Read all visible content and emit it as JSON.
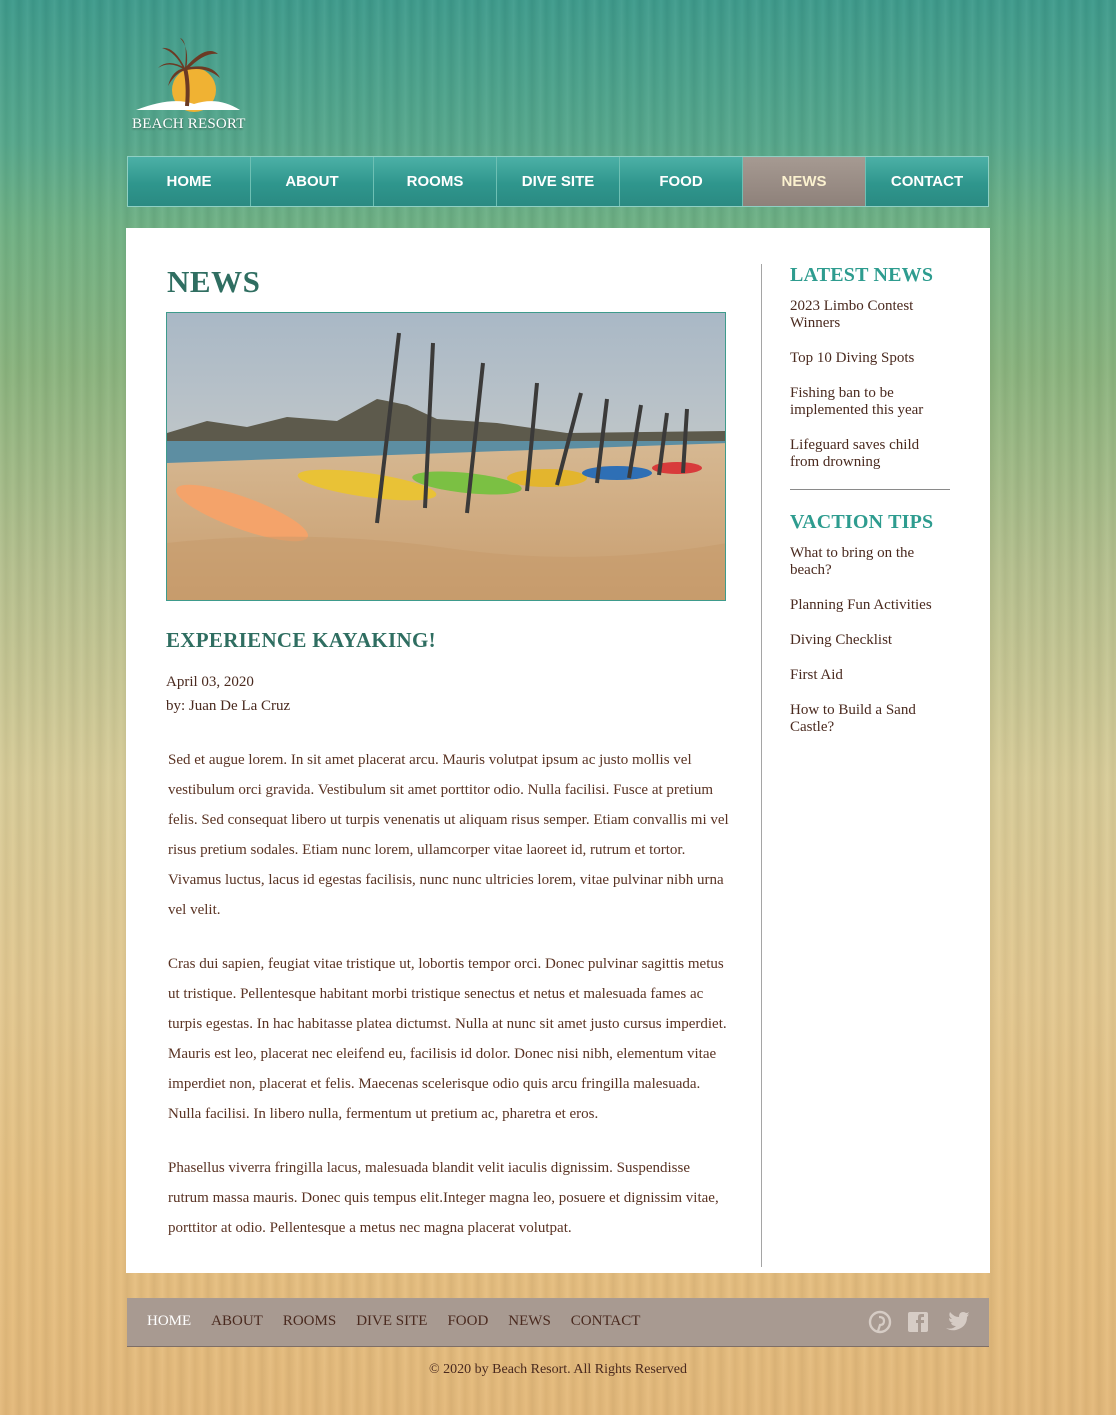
{
  "logo": {
    "text": "BEACH RESORT"
  },
  "nav": {
    "items": [
      {
        "label": "HOME"
      },
      {
        "label": "ABOUT"
      },
      {
        "label": "ROOMS"
      },
      {
        "label": "DIVE SITE"
      },
      {
        "label": "FOOD"
      },
      {
        "label": "NEWS",
        "active": true
      },
      {
        "label": "CONTACT"
      }
    ]
  },
  "main": {
    "title": "NEWS",
    "article": {
      "title": "EXPERIENCE KAYAKING!",
      "date": "April 03, 2020",
      "author": "by: Juan De La Cruz",
      "paragraphs": [
        "Sed et augue lorem. In sit amet placerat arcu. Mauris volutpat ipsum ac justo mollis vel vestibulum orci gravida. Vestibulum sit amet porttitor odio. Nulla facilisi. Fusce at pretium felis. Sed consequat libero ut turpis venenatis ut aliquam risus semper. Etiam convallis mi vel risus pretium sodales. Etiam nunc lorem, ullamcorper vitae laoreet id, rutrum et tortor. Vivamus luctus, lacus id egestas facilisis, nunc nunc ultricies lorem, vitae pulvinar nibh urna vel velit.",
        "Cras dui sapien, feugiat vitae tristique ut, lobortis tempor orci. Donec pulvinar sagittis metus ut tristique. Pellentesque habitant morbi tristique senectus et netus et malesuada fames ac turpis egestas. In hac habitasse platea dictumst. Nulla at nunc sit amet justo cursus imperdiet. Mauris est leo, placerat nec eleifend eu, facilisis id dolor. Donec nisi nibh, elementum vitae imperdiet non, placerat et felis. Maecenas scelerisque odio quis arcu fringilla malesuada. Nulla facilisi. In libero nulla, fermentum ut pretium ac, pharetra et eros.",
        "Phasellus viverra fringilla lacus, malesuada blandit velit iaculis dignissim. Suspendisse rutrum massa mauris. Donec quis tempus elit.Integer magna leo, posuere et dignissim vitae, porttitor at odio. Pellentesque a metus nec magna placerat volutpat."
      ]
    }
  },
  "sidebar": {
    "latest_news": {
      "title": "LATEST NEWS",
      "items": [
        {
          "label": "2023 Limbo Contest Winners"
        },
        {
          "label": "Top 10 Diving Spots"
        },
        {
          "label": "Fishing ban to be implemented this year"
        },
        {
          "label": "Lifeguard saves child from drowning"
        }
      ]
    },
    "vacation_tips": {
      "title": "VACTION TIPS",
      "items": [
        {
          "label": "What to bring on the beach?"
        },
        {
          "label": "Planning Fun Activities"
        },
        {
          "label": "Diving Checklist"
        },
        {
          "label": "First Aid"
        },
        {
          "label": "How to Build a Sand Castle?"
        }
      ]
    }
  },
  "footer": {
    "nav": [
      {
        "label": "HOME",
        "active": true
      },
      {
        "label": "ABOUT"
      },
      {
        "label": "ROOMS"
      },
      {
        "label": "DIVE SITE"
      },
      {
        "label": "FOOD"
      },
      {
        "label": "NEWS"
      },
      {
        "label": "CONTACT"
      }
    ],
    "social": [
      "pinterest-icon",
      "facebook-icon",
      "twitter-icon"
    ],
    "copyright": "© 2020 by Beach Resort. All Rights Reserved"
  },
  "colors": {
    "accent_teal": "#2e9c8f",
    "heading_green": "#2f6e61",
    "nav_active": "#8e817a",
    "text_brown": "#4a2a1f",
    "footer_bar": "#a89a91"
  }
}
